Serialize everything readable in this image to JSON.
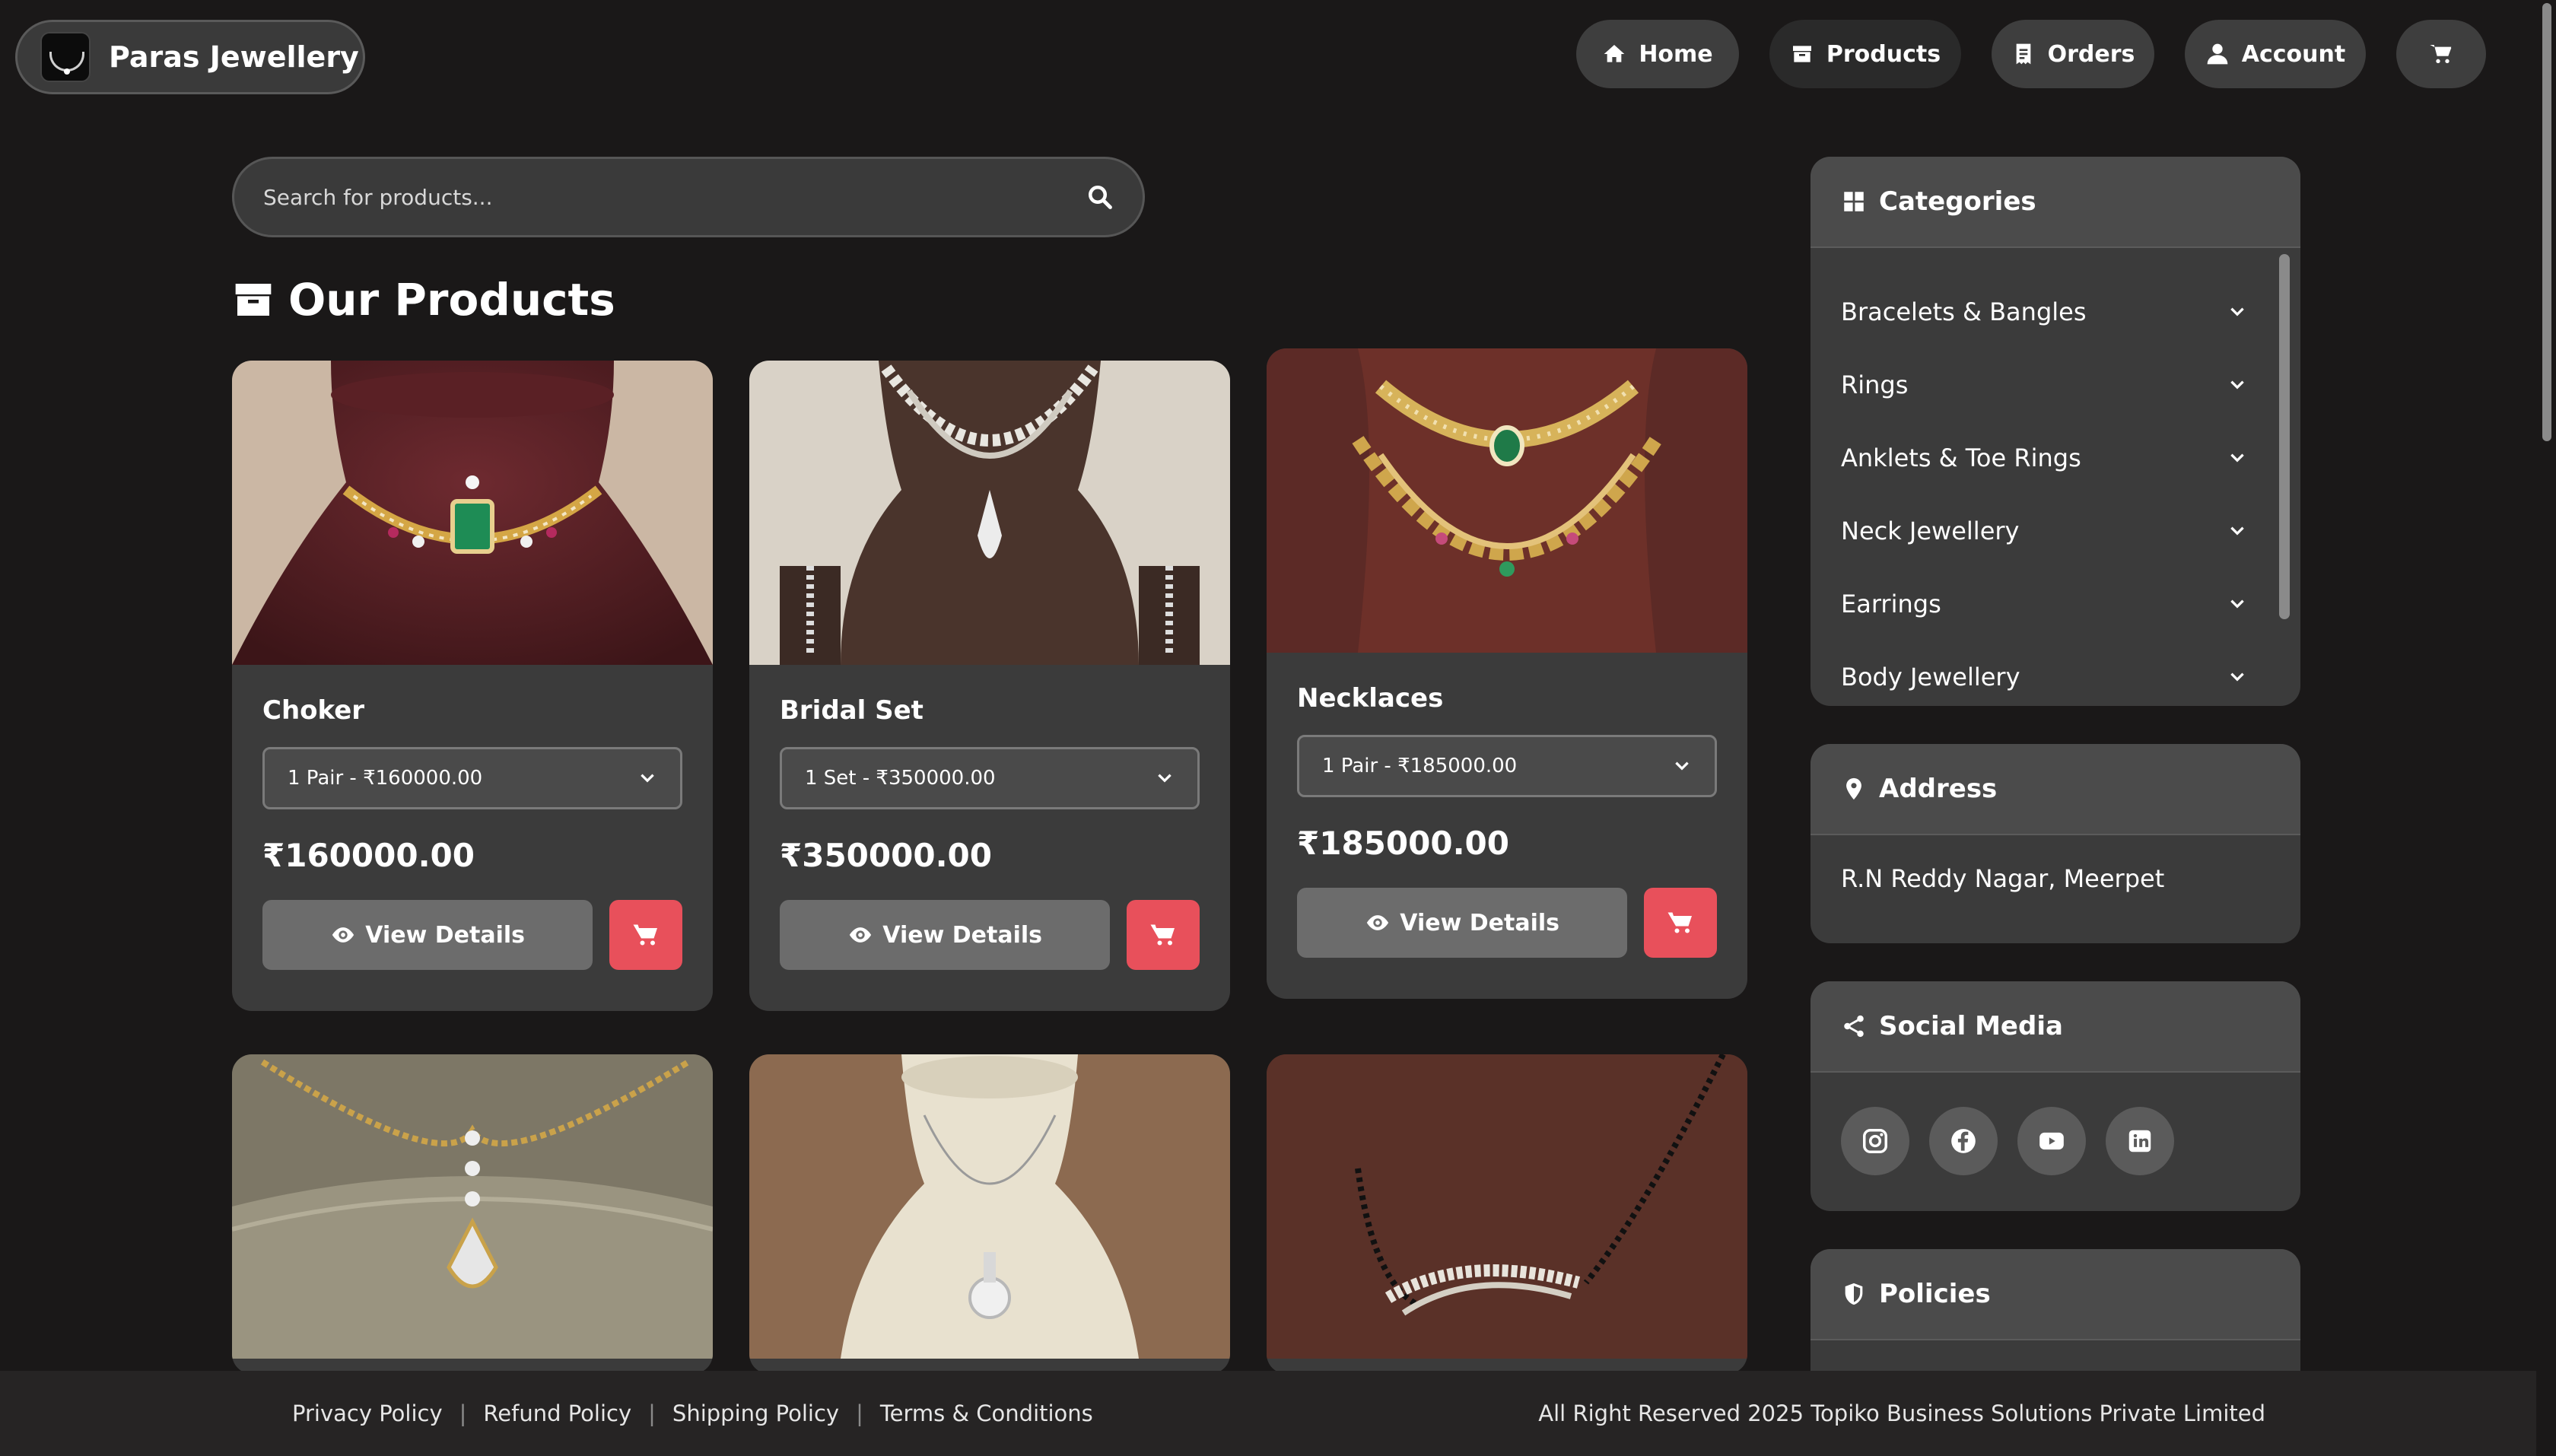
{
  "brand": {
    "name": "Paras Jewellery"
  },
  "nav": [
    {
      "label": "Home",
      "icon": "home-icon"
    },
    {
      "label": "Products",
      "icon": "box-icon"
    },
    {
      "label": "Orders",
      "icon": "receipt-icon"
    },
    {
      "label": "Account",
      "icon": "user-icon"
    },
    {
      "label": "",
      "icon": "cart-icon"
    }
  ],
  "search": {
    "placeholder": "Search for products...",
    "value": ""
  },
  "section_title": "Our Products",
  "products": [
    {
      "name": "Choker",
      "variant": "1 Pair - ₹160000.00",
      "price": "₹160000.00",
      "view_label": "View Details"
    },
    {
      "name": "Bridal Set",
      "variant": "1 Set - ₹350000.00",
      "price": "₹350000.00",
      "view_label": "View Details"
    },
    {
      "name": "Necklaces",
      "variant": "1 Pair - ₹185000.00",
      "price": "₹185000.00",
      "view_label": "View Details"
    }
  ],
  "sidebar": {
    "categories_title": "Categories",
    "categories": [
      "Bracelets & Bangles",
      "Rings",
      "Anklets & Toe Rings",
      "Neck Jewellery",
      "Earrings",
      "Body Jewellery"
    ],
    "address_title": "Address",
    "address": "R.N Reddy Nagar, Meerpet",
    "social_title": "Social Media",
    "social": [
      "instagram-icon",
      "facebook-icon",
      "youtube-icon",
      "linkedin-icon"
    ],
    "policies_title": "Policies"
  },
  "footer": {
    "links": [
      "Privacy Policy",
      "Refund Policy",
      "Shipping Policy",
      "Terms & Conditions"
    ],
    "copyright": "All Right Reserved 2025 Topiko Business Solutions Private Limited"
  },
  "colors": {
    "accent": "#e8505b",
    "background": "#1a1818",
    "card": "#3b3b3b"
  }
}
